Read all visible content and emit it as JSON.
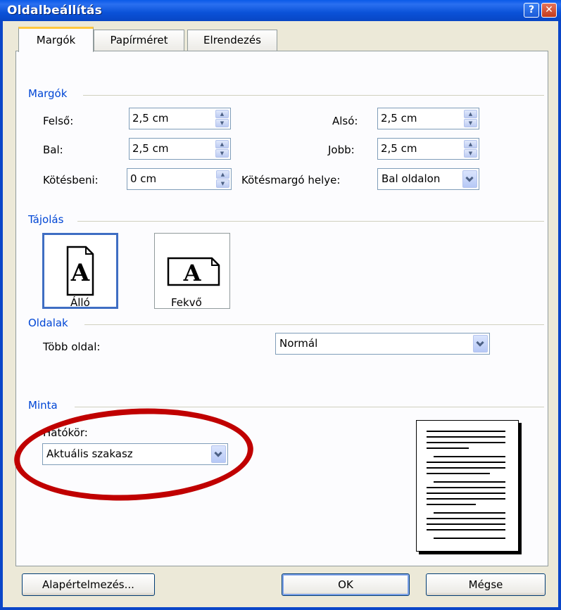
{
  "window": {
    "title": "Oldalbeállítás",
    "help_label": "?",
    "close_label": "✕"
  },
  "tabs": [
    {
      "label": "Margók"
    },
    {
      "label": "Papírméret"
    },
    {
      "label": "Elrendezés"
    }
  ],
  "margins": {
    "group_label": "Margók",
    "top_label": "Felső:",
    "top_value": "2,5 cm",
    "bottom_label": "Alsó:",
    "bottom_value": "2,5 cm",
    "left_label": "Bal:",
    "left_value": "2,5 cm",
    "right_label": "Jobb:",
    "right_value": "2,5 cm",
    "gutter_label": "Kötésbeni:",
    "gutter_value": "0 cm",
    "gutter_pos_label": "Kötésmargó helye:",
    "gutter_pos_value": "Bal oldalon"
  },
  "orientation": {
    "group_label": "Tájolás",
    "portrait_label": "Álló",
    "landscape_label": "Fekvő",
    "icon_letter": "A",
    "selected": "portrait"
  },
  "pages": {
    "group_label": "Oldalak",
    "multiple_label": "Több oldal:",
    "multiple_value": "Normál"
  },
  "preview": {
    "group_label": "Minta",
    "apply_label": "Hatókör:",
    "apply_value": "Aktuális szakasz"
  },
  "buttons": {
    "default_label": "Alapértelmezés...",
    "ok_label": "OK",
    "cancel_label": "Mégse"
  },
  "colors": {
    "title_bar": "#0a52d8",
    "group_label": "#0046d5",
    "highlight_ellipse": "#c00000",
    "tab_accent": "#ffc83c"
  }
}
